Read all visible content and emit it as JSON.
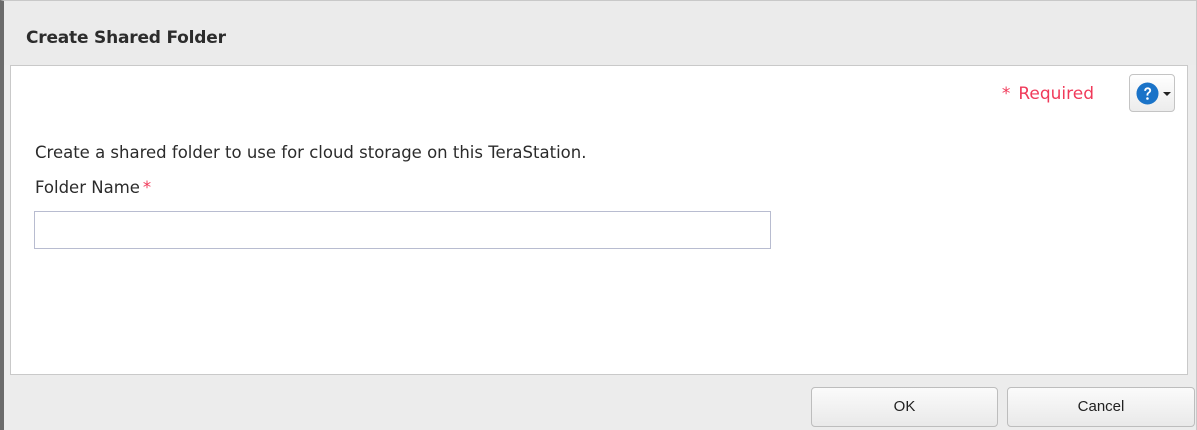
{
  "dialog": {
    "title": "Create Shared Folder"
  },
  "header": {
    "required_star": "*",
    "required_label": "Required",
    "help_icon": "question-circle-icon",
    "help_caret_icon": "caret-down-icon"
  },
  "form": {
    "description": "Create a shared folder to use for cloud storage on this TeraStation.",
    "folder_name_label": "Folder Name",
    "folder_name_required": "*",
    "folder_name_value": "",
    "folder_name_placeholder": ""
  },
  "buttons": {
    "ok": "OK",
    "cancel": "Cancel"
  },
  "colors": {
    "required": "#f03a5a",
    "help_icon": "#1a73c8",
    "title_bar": "#ebebeb"
  }
}
